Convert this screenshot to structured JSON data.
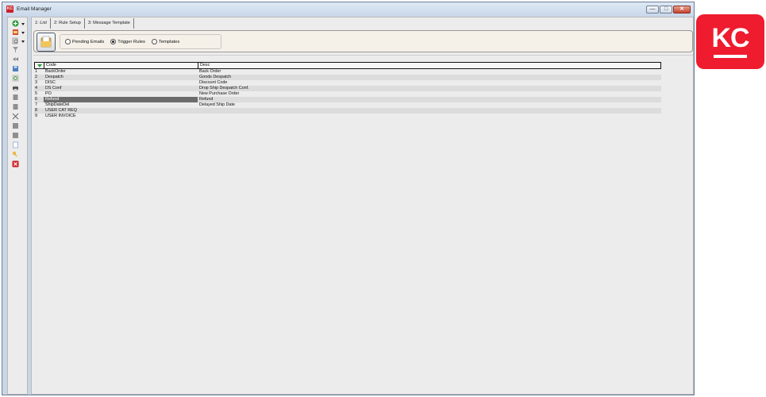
{
  "window": {
    "title": "Email Manager",
    "app_icon_text": "KC",
    "controls": {
      "minimize": "—",
      "maximize": "□",
      "close": "✕"
    }
  },
  "tabs": [
    {
      "label": "1: List",
      "active": true
    },
    {
      "label": "2: Rule Setup",
      "active": false
    },
    {
      "label": "3: Message Template",
      "active": false
    }
  ],
  "filter": {
    "options": [
      {
        "label": "Pending Emails",
        "selected": false
      },
      {
        "label": "Trigger Rules",
        "selected": true
      },
      {
        "label": "Templates",
        "selected": false
      }
    ]
  },
  "grid": {
    "columns": {
      "code": "Code",
      "desc": "Desc"
    },
    "rows": [
      {
        "num": "1",
        "code": "BackOrder",
        "desc": "Back Order"
      },
      {
        "num": "2",
        "code": "Despatch",
        "desc": "Goods Despatch"
      },
      {
        "num": "3",
        "code": "DISC",
        "desc": "Discount Code"
      },
      {
        "num": "4",
        "code": "DS Conf",
        "desc": "Drop Ship Despatch Conf."
      },
      {
        "num": "5",
        "code": "PO",
        "desc": "New Purchase Order"
      },
      {
        "num": "6",
        "code": "Refund",
        "desc": "Refund"
      },
      {
        "num": "7",
        "code": "ShipDateDel",
        "desc": "Delayed Ship Date"
      },
      {
        "num": "8",
        "code": "USER CAT REQ",
        "desc": ""
      },
      {
        "num": "9",
        "code": "USER INVOICE",
        "desc": ""
      }
    ],
    "selected_row": 6
  },
  "brand": {
    "text": "KC",
    "color": "#ee1c2e"
  },
  "toolbar_icons": [
    "add-icon",
    "print-preview-icon",
    "search-icon",
    "filter-icon",
    "rewind-icon",
    "save-icon",
    "refresh-icon",
    "printer-icon",
    "page-icon",
    "page-icon",
    "cut-icon",
    "box-icon",
    "box-icon",
    "document-icon",
    "key-icon",
    "exit-icon"
  ]
}
